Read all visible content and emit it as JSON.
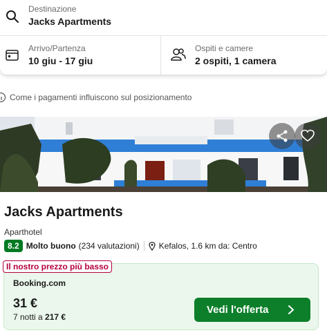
{
  "search": {
    "destination_label": "Destinazione",
    "destination_value": "Jacks Apartments",
    "dates_label": "Arrivo/Partenza",
    "dates_value": "10 giu - 17 giu",
    "guests_label": "Ospiti e camere",
    "guests_value": "2 ospiti, 1 camera"
  },
  "info": {
    "text": "Come i pagamenti influiscono sul posizionamento"
  },
  "hotel": {
    "name": "Jacks Apartments",
    "type": "Aparthotel",
    "score": "8.2",
    "score_text": "Molto buono",
    "reviews": "(234 valutazioni)",
    "location": "Kefalos, 1.6 km da: Centro"
  },
  "offer": {
    "badge": "Il nostro prezzo più basso",
    "provider": "Booking.com",
    "price": "31 €",
    "nights_prefix": "7 notti a",
    "total": "217 €",
    "cta": "Vedi l'offerta"
  },
  "icons": {
    "search": "search-icon",
    "calendar": "calendar-icon",
    "guests": "guests-icon",
    "info": "info-icon",
    "share": "share-icon",
    "favorite": "heart-icon",
    "pin": "map-pin-icon",
    "chevron": "chevron-right-icon"
  },
  "colors": {
    "score_badge": "#007a22",
    "cta": "#0d7f2a",
    "offer_bg": "#ebf7ec",
    "badge_red": "#b4003c"
  }
}
